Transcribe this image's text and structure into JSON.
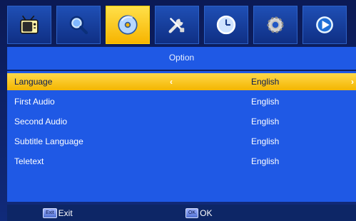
{
  "tabs": [
    {
      "name": "tv",
      "icon": "tv-icon",
      "active": false
    },
    {
      "name": "search",
      "icon": "search-icon",
      "active": false
    },
    {
      "name": "disc",
      "icon": "disc-icon",
      "active": true
    },
    {
      "name": "tools",
      "icon": "tools-icon",
      "active": false
    },
    {
      "name": "time",
      "icon": "clock-icon",
      "active": false
    },
    {
      "name": "settings",
      "icon": "gear-icon",
      "active": false
    },
    {
      "name": "media",
      "icon": "play-icon",
      "active": false
    }
  ],
  "panel": {
    "title": "Option",
    "rows": [
      {
        "label": "Language",
        "value": "English",
        "selected": true
      },
      {
        "label": "First Audio",
        "value": "English",
        "selected": false
      },
      {
        "label": "Second Audio",
        "value": "English",
        "selected": false
      },
      {
        "label": "Subtitle Language",
        "value": "English",
        "selected": false
      },
      {
        "label": "Teletext",
        "value": "English",
        "selected": false
      }
    ],
    "arrow_left": "‹",
    "arrow_right": "›"
  },
  "help": {
    "exit_key": "Exit",
    "exit_label": "Exit",
    "ok_key": "OK",
    "ok_label": "OK"
  },
  "colors": {
    "accent_yellow": "#f7b400",
    "panel_blue": "#1f59e5",
    "background": "#0c1b52"
  }
}
